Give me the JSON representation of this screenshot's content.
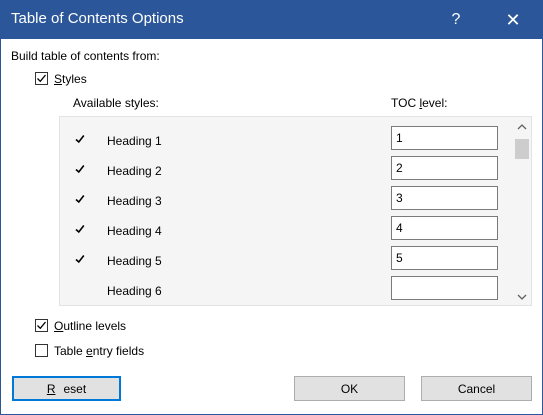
{
  "dialog": {
    "title": "Table of Contents Options",
    "help": "?",
    "close": "✕"
  },
  "build_label": "Build table of contents from:",
  "styles_check": {
    "label_u": "S",
    "label_rest": "tyles",
    "checked": true
  },
  "available_label": "Available styles:",
  "toc_label_pre": "TOC ",
  "toc_label_u": "l",
  "toc_label_post": "evel:",
  "styles": [
    {
      "name": "Heading 1",
      "level": "1",
      "checked": true
    },
    {
      "name": "Heading 2",
      "level": "2",
      "checked": true
    },
    {
      "name": "Heading 3",
      "level": "3",
      "checked": true
    },
    {
      "name": "Heading 4",
      "level": "4",
      "checked": true
    },
    {
      "name": "Heading 5",
      "level": "5",
      "checked": true
    },
    {
      "name": "Heading 6",
      "level": "",
      "checked": false
    }
  ],
  "outline_check": {
    "label_u": "O",
    "label_rest": "utline levels",
    "checked": true
  },
  "entry_check": {
    "label_pre": "Table ",
    "label_u": "e",
    "label_rest": "ntry fields",
    "checked": false
  },
  "buttons": {
    "reset_u": "R",
    "reset_rest": "eset",
    "ok": "OK",
    "cancel": "Cancel"
  }
}
